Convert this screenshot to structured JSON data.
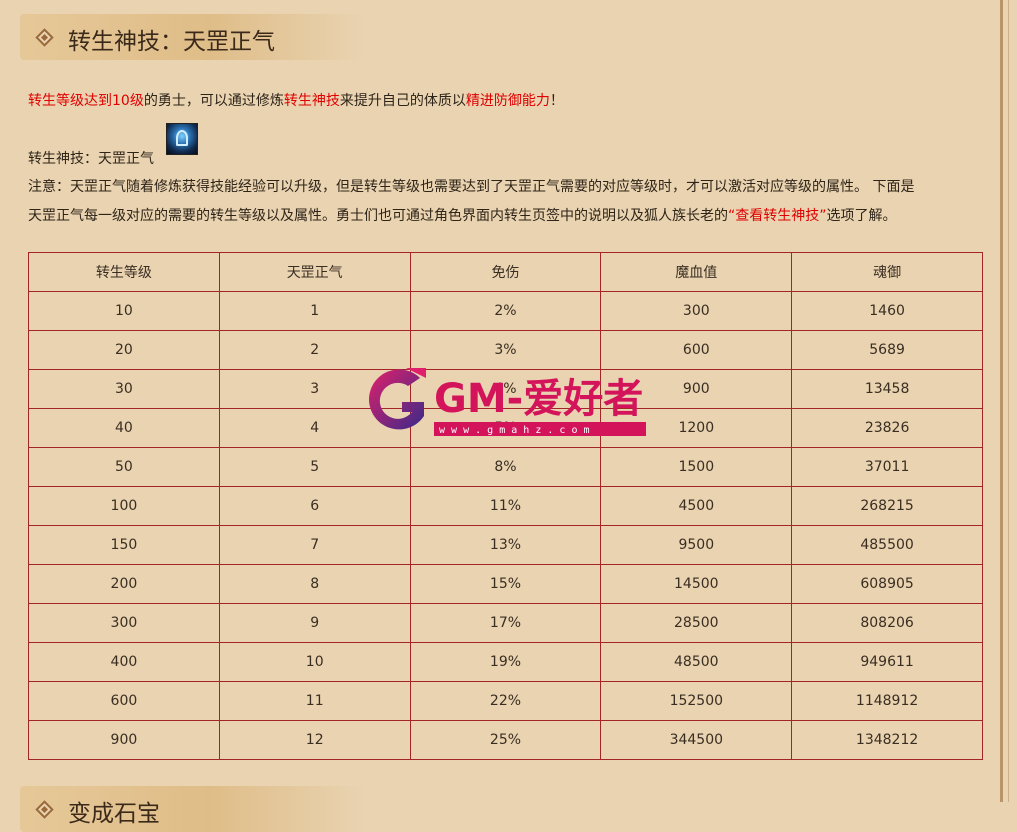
{
  "section1": {
    "title": "转生神技：天罡正气"
  },
  "section2": {
    "title": "变成石宝"
  },
  "intro": {
    "part1": "转生等级达到10级",
    "part2": "的勇士，可以通过修炼",
    "part3": "转生神技",
    "part4": "来提升自己的体质以",
    "part5": "精进防御能力",
    "part6": "！"
  },
  "skill_label": "转生神技：天罡正气",
  "skill_icon": "skill-icon",
  "note": {
    "line1": "注意：天罡正气随着修炼获得技能经验可以升级，但是转生等级也需要达到了天罡正气需要的对应等级时，才可以激活对应等级的属性。 下面是",
    "line2a": "天罡正气每一级对应的需要的转生等级以及属性。勇士们也可通过角色界面内转生页签中的说明以及狐人族长老的",
    "line2b": "“查看转生神技”",
    "line2c": "选项了解。"
  },
  "table": {
    "headers": [
      "转生等级",
      "天罡正气",
      "免伤",
      "魔血值",
      "魂御"
    ],
    "rows": [
      [
        "10",
        "1",
        "2%",
        "300",
        "1460"
      ],
      [
        "20",
        "2",
        "3%",
        "600",
        "5689"
      ],
      [
        "30",
        "3",
        "4%",
        "900",
        "13458"
      ],
      [
        "40",
        "4",
        "5%",
        "1200",
        "23826"
      ],
      [
        "50",
        "5",
        "8%",
        "1500",
        "37011"
      ],
      [
        "100",
        "6",
        "11%",
        "4500",
        "268215"
      ],
      [
        "150",
        "7",
        "13%",
        "9500",
        "485500"
      ],
      [
        "200",
        "8",
        "15%",
        "14500",
        "608905"
      ],
      [
        "300",
        "9",
        "17%",
        "28500",
        "808206"
      ],
      [
        "400",
        "10",
        "19%",
        "48500",
        "949611"
      ],
      [
        "600",
        "11",
        "22%",
        "152500",
        "1148912"
      ],
      [
        "900",
        "12",
        "25%",
        "344500",
        "1348212"
      ]
    ]
  },
  "watermark": {
    "brand": "GM-爱好者",
    "url": "w w w . g m a h z . c o m"
  },
  "colors": {
    "accent": "#e00000",
    "border": "#a42525",
    "background": "#e9d3b1",
    "watermark": "#d4145a"
  }
}
